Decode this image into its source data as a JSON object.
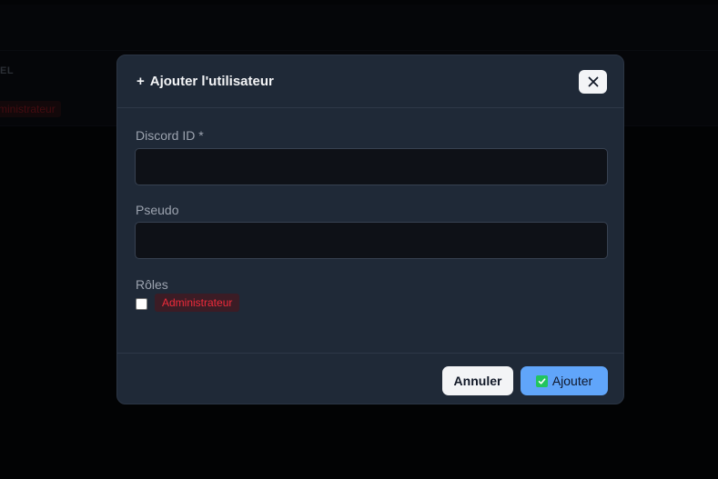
{
  "background": {
    "column_label": "EL",
    "role_badge": "ministrateur"
  },
  "modal": {
    "title_icon": "+",
    "title": "Ajouter l'utilisateur",
    "close_icon": "close-icon",
    "fields": {
      "discord_id": {
        "label": "Discord ID *",
        "value": ""
      },
      "pseudo": {
        "label": "Pseudo",
        "value": ""
      }
    },
    "roles": {
      "label": "Rôles",
      "options": [
        {
          "label": "Administrateur",
          "checked": false,
          "color": "#ef2b3b"
        }
      ]
    },
    "footer": {
      "cancel_label": "Annuler",
      "add_label": "Ajouter",
      "add_icon": "check-box-icon"
    }
  },
  "colors": {
    "accent": "#60a5fa",
    "danger": "#ef2b3b",
    "modal_bg": "#1f2937"
  }
}
